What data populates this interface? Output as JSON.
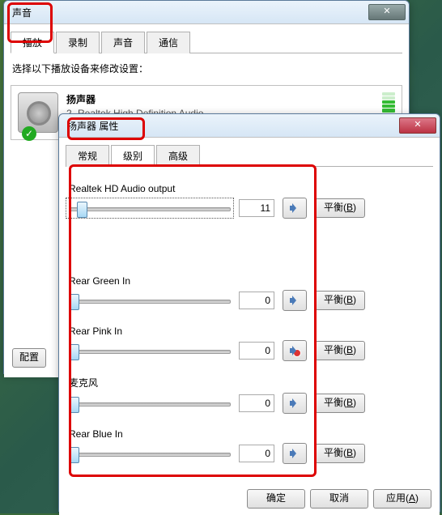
{
  "sound_window": {
    "title": "声音",
    "tabs": [
      "播放",
      "录制",
      "声音",
      "通信"
    ],
    "active_tab": 0,
    "hint": "选择以下播放设备来修改设置：",
    "device": {
      "name": "扬声器",
      "line2": "2- Realtek High Definition Audio",
      "status": "默认设备"
    },
    "config_btn": "配置"
  },
  "props_window": {
    "title": "扬声器 属性",
    "tabs": [
      "常规",
      "级别",
      "高级"
    ],
    "active_tab": 1,
    "balance_label": "平衡",
    "balance_key": "B",
    "buttons": {
      "ok": "确定",
      "cancel": "取消",
      "apply": "应用",
      "apply_key": "A"
    },
    "channels": [
      {
        "label": "Realtek HD Audio output",
        "value": 11,
        "pos": 5,
        "muted": false,
        "highlight": true
      },
      {
        "label": "Rear Green In",
        "value": 0,
        "pos": 0,
        "muted": false
      },
      {
        "label": "Rear Pink In",
        "value": 0,
        "pos": 0,
        "muted": true
      },
      {
        "label": "麦克风",
        "value": 0,
        "pos": 0,
        "muted": false
      },
      {
        "label": "Rear Blue In",
        "value": 0,
        "pos": 0,
        "muted": false
      }
    ]
  }
}
